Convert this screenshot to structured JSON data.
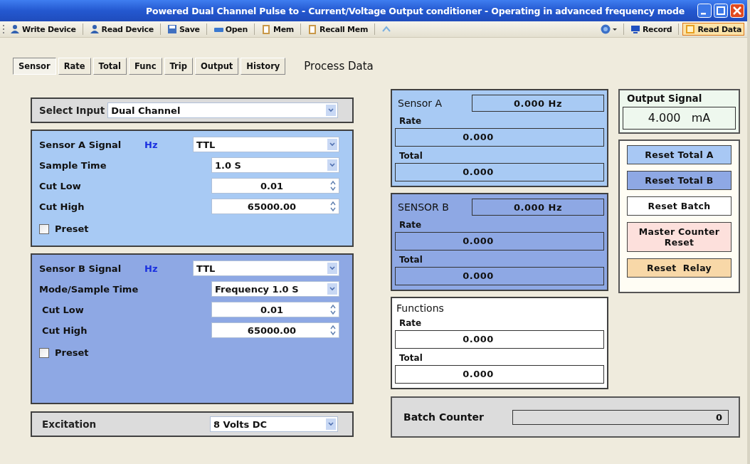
{
  "window": {
    "title": "Powered  Dual Channel Pulse to - Current/Voltage Output conditioner - Operating in advanced frequency mode"
  },
  "toolbar": {
    "left": [
      {
        "label": "Write Device"
      },
      {
        "label": "Read Device"
      },
      {
        "label": "Save"
      },
      {
        "label": "Open"
      },
      {
        "label": "Mem"
      },
      {
        "label": "Recall Mem"
      }
    ],
    "right": [
      {
        "kind": "icon",
        "selected": false
      },
      {
        "label": "Record",
        "selected": false
      },
      {
        "label": "Read Data",
        "selected": true
      }
    ]
  },
  "tabs": [
    {
      "label": "Sensor",
      "selected": true
    },
    {
      "label": "Rate",
      "selected": false
    },
    {
      "label": "Total",
      "selected": false
    },
    {
      "label": "Func",
      "selected": false
    },
    {
      "label": "Trip",
      "selected": false
    },
    {
      "label": "Output",
      "selected": false
    },
    {
      "label": "History",
      "selected": false
    }
  ],
  "section_title": "Process Data",
  "select_input": {
    "label": "Select Input",
    "value": "Dual Channel"
  },
  "sensors": [
    {
      "title": "Sensor A Signal",
      "unit": "Hz",
      "signal": "TTL",
      "color": "#a8caf4",
      "rows": [
        {
          "label": "Sample Time",
          "value": "1.0  S",
          "kind": "dropdown"
        },
        {
          "label": "Cut Low",
          "value": "0.01",
          "kind": "spinner"
        },
        {
          "label": "Cut High",
          "value": "65000.00",
          "kind": "spinner"
        }
      ],
      "preset": {
        "label": "Preset",
        "checked": false
      }
    },
    {
      "title": "Sensor B Signal",
      "unit": "Hz",
      "signal": "TTL",
      "color": "#8ea8e4",
      "rows": [
        {
          "label": "Mode/Sample Time",
          "value": "Frequency 1.0  S",
          "kind": "dropdown"
        },
        {
          "label": "Cut Low",
          "value": "0.01",
          "kind": "spinner"
        },
        {
          "label": "Cut High",
          "value": "65000.00",
          "kind": "spinner"
        }
      ],
      "preset": {
        "label": "Preset",
        "checked": false
      }
    }
  ],
  "excitation": {
    "label": "Excitation",
    "value": "8  Volts DC"
  },
  "process": [
    {
      "title": "Sensor A",
      "frequency": "0.000   Hz",
      "rate_label": "Rate",
      "rate": "0.000",
      "total_label": "Total",
      "total": "0.000",
      "color": "#a8caf4"
    },
    {
      "title": "SENSOR B",
      "frequency": "0.000   Hz",
      "rate_label": "Rate",
      "rate": "0.000",
      "total_label": "Total",
      "total": "0.000",
      "color": "#8ea8e4"
    }
  ],
  "functions": {
    "title": "Functions",
    "rate_label": "Rate",
    "rate": "0.000",
    "total_label": "Total",
    "total": "0.000"
  },
  "output_signal": {
    "title": "Output Signal",
    "value": "4.000   mA"
  },
  "reset_buttons": [
    {
      "label": "Reset Total A",
      "color": "#a8c8f4"
    },
    {
      "label": "Reset Total B",
      "color": "#8ea8e4"
    },
    {
      "label": "Reset Batch",
      "color": "#ffffff"
    },
    {
      "label": "Master Counter Reset",
      "color": "#fde0dc"
    },
    {
      "label": "Reset  Relay",
      "color": "#f8d8a8"
    }
  ],
  "batch_counter": {
    "label": "Batch Counter",
    "value": "0"
  }
}
